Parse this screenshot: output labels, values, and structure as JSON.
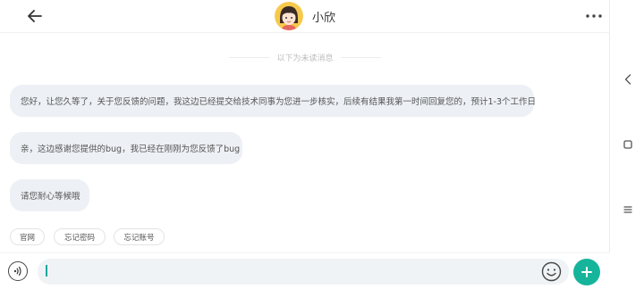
{
  "header": {
    "contact_name": "小欣",
    "back_icon": "arrow-left-icon",
    "more_icon": "more-dots-icon"
  },
  "divider_text": "以下为未读消息",
  "messages": [
    {
      "text": "您好，让您久等了，关于您反馈的问题，我这边已经提交给技术同事为您进一步核实，后续有结果我第一时间回复您的，预计1-3个工作日"
    },
    {
      "text": "亲，这边感谢您提供的bug，我已经在刚刚为您反馈了bug"
    },
    {
      "text": "请您耐心等候哦"
    }
  ],
  "quick_replies": [
    "官网",
    "忘记密码",
    "忘记账号"
  ],
  "input_bar": {
    "value": "",
    "voice_icon": "voice-icon",
    "emoji_icon": "emoji-icon",
    "add_icon": "plus-icon"
  },
  "colors": {
    "accent": "#16b49b",
    "bubble_bg": "#edf0f4",
    "input_bg": "#f0f3f6"
  },
  "nav_rail": [
    "nav-back-icon",
    "nav-home-icon",
    "nav-menu-icon"
  ]
}
